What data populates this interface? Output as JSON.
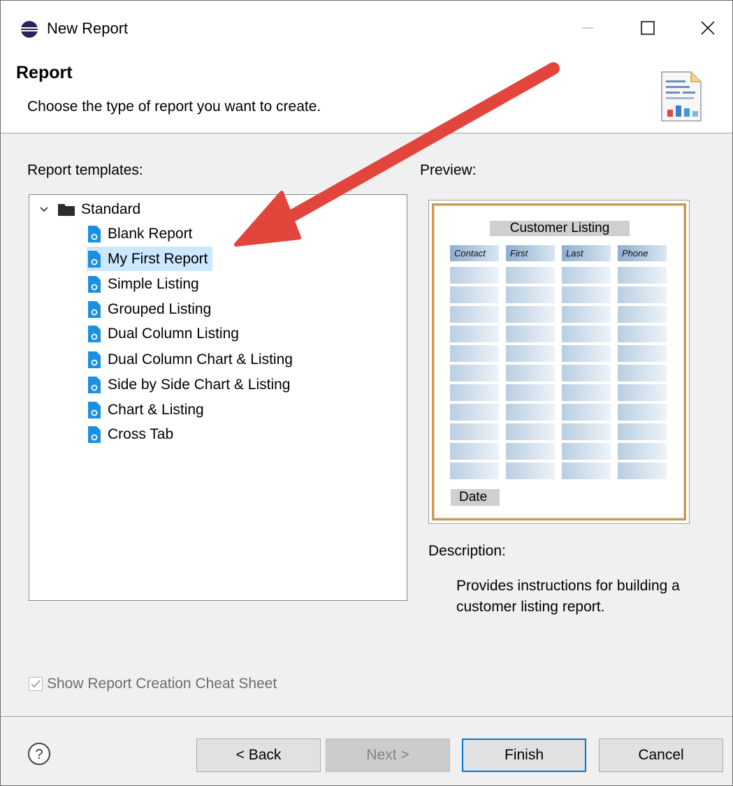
{
  "window": {
    "title": "New Report",
    "app_icon": "eclipse-icon"
  },
  "header": {
    "title": "Report",
    "description": "Choose the type of report you want to create.",
    "icon": "report-chart-icon"
  },
  "templates": {
    "label": "Report templates:",
    "root": "Standard",
    "items": [
      "Blank Report",
      "My First Report",
      "Simple Listing",
      "Grouped Listing",
      "Dual Column Listing",
      "Dual Column Chart & Listing",
      "Side by Side Chart & Listing",
      "Chart & Listing",
      "Cross Tab"
    ],
    "selected": "My First Report"
  },
  "preview": {
    "label": "Preview:",
    "title": "Customer Listing",
    "columns": [
      "Contact",
      "First",
      "Last",
      "Phone"
    ],
    "footer": "Date"
  },
  "description": {
    "label": "Description:",
    "text": "Provides instructions for building a customer listing report."
  },
  "cheat_sheet": {
    "label": "Show Report Creation Cheat Sheet",
    "checked": true
  },
  "buttons": {
    "back": "< Back",
    "next": "Next >",
    "finish": "Finish",
    "cancel": "Cancel"
  },
  "colors": {
    "selection": "#cce8ff",
    "arrow": "#e2453c",
    "accent": "#0078d7"
  }
}
